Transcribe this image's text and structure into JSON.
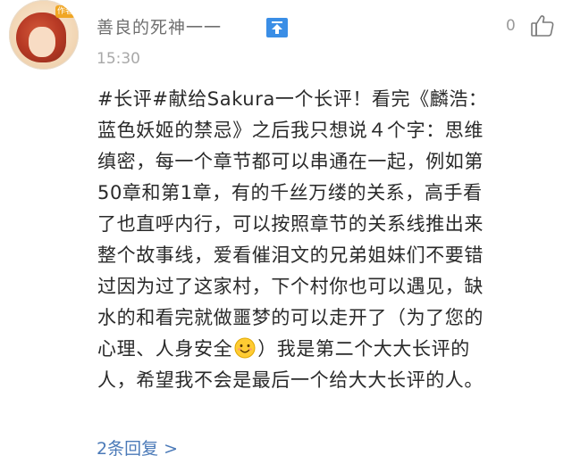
{
  "comment": {
    "username": "善良的死神一一",
    "avatar_badge": "作者",
    "timestamp": "15:30",
    "like_count": "0",
    "body_lines": [
      "#长评#献给Sakura一个长评！看完《麟浩：",
      "蓝色妖姬的禁忌》之后我只想说４个字：思维",
      "缜密，每一个章节都可以串通在一起，例如第",
      "50章和第1章，有的千丝万缕的关系，高手看",
      "了也直呼内行，可以按照章节的关系线推出来",
      "整个故事线，爱看催泪文的兄弟姐妹们不要错",
      "过因为过了这家村，下个村你也可以遇见，缺",
      "水的和看完就做噩梦的可以走开了（为了您的",
      "心理、人身安全",
      "）我是第二个大大长评的",
      "人，希望我不会是最后一个给大大长评的人。"
    ],
    "replies_label": "2条回复 >"
  },
  "icons": {
    "pin": "pin-top-icon",
    "like": "thumbs-up-icon",
    "emoji": "smiling-face-emoji"
  },
  "colors": {
    "username": "#6f6f6f",
    "timestamp": "#a8a8a8",
    "body_text": "#2a2a2a",
    "link": "#4b7ab8",
    "pin_bg": "#3a8ee6"
  }
}
